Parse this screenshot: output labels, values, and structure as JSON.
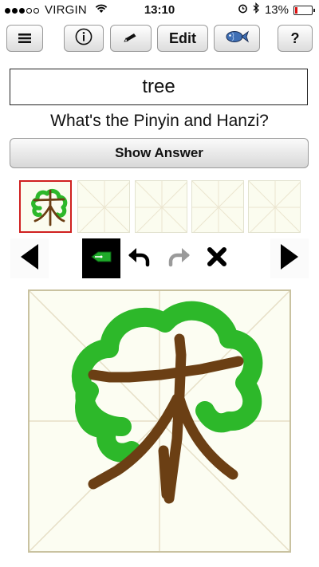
{
  "status_bar": {
    "carrier": "VIRGIN",
    "time": "13:10",
    "battery": "13%",
    "battery_level": 0.13
  },
  "toolbar": {
    "menu_icon": "menu-icon",
    "info_icon": "info-icon",
    "pencil_icon": "pencil-icon",
    "edit_label": "Edit",
    "fish_icon": "fish-icon",
    "help_label": "?"
  },
  "card": {
    "word": "tree",
    "question": "What's the Pinyin and Hanzi?",
    "show_answer_label": "Show Answer"
  },
  "drawing_tools": {
    "prev_icon": "prev-arrow-icon",
    "pen_icon": "pen-icon",
    "undo_icon": "undo-icon",
    "redo_icon": "redo-icon",
    "clear_icon": "clear-icon",
    "next_icon": "next-arrow-icon"
  },
  "colors": {
    "tree_green": "#2db82a",
    "trunk_brown": "#6b3f14",
    "paper": "#fcfdf2",
    "grid": "#e6dfc6",
    "active_thumb": "#d02020"
  }
}
